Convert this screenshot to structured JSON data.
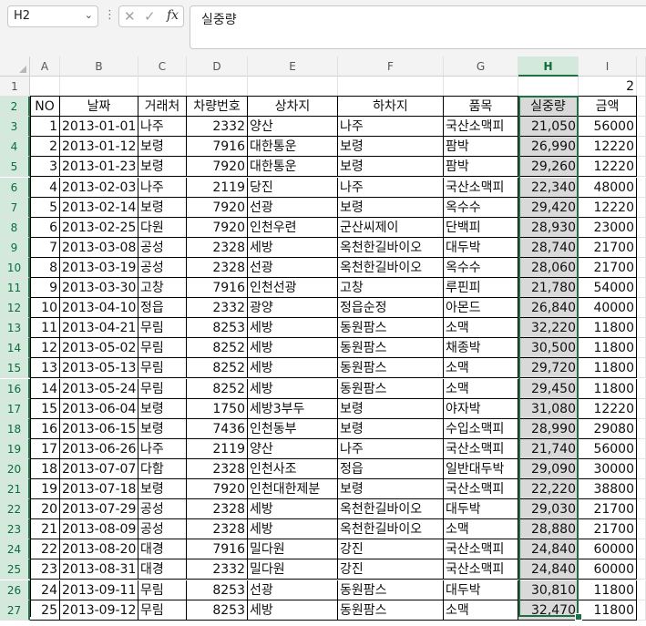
{
  "name_box": {
    "value": "H2"
  },
  "formula_bar": {
    "value": "실중량",
    "fx_label": "fx"
  },
  "columns": [
    "A",
    "B",
    "C",
    "D",
    "E",
    "F",
    "G",
    "H",
    "I"
  ],
  "selected_column": "H",
  "row1": {
    "I": "2"
  },
  "headers": [
    "NO",
    "날짜",
    "거래처",
    "차량번호",
    "상차지",
    "하차지",
    "품목",
    "실중량",
    "금액"
  ],
  "rows": [
    [
      "1",
      "2013-01-01",
      "나주",
      "2332",
      "양산",
      "나주",
      "국산소맥피",
      "21,050",
      "56000"
    ],
    [
      "2",
      "2013-01-12",
      "보령",
      "7916",
      "대한통운",
      "보령",
      "팜박",
      "26,990",
      "12220"
    ],
    [
      "3",
      "2013-01-23",
      "보령",
      "7920",
      "대한통운",
      "보령",
      "팜박",
      "29,260",
      "12220"
    ],
    [
      "4",
      "2013-02-03",
      "나주",
      "2119",
      "당진",
      "나주",
      "국산소맥피",
      "22,340",
      "48000"
    ],
    [
      "5",
      "2013-02-14",
      "보령",
      "7920",
      "선광",
      "보령",
      "옥수수",
      "29,420",
      "12220"
    ],
    [
      "6",
      "2013-02-25",
      "다원",
      "7920",
      "인천우련",
      "군산씨제이",
      "단백피",
      "28,930",
      "23000"
    ],
    [
      "7",
      "2013-03-08",
      "공성",
      "2328",
      "세방",
      "옥천한길바이오",
      "대두박",
      "28,740",
      "21700"
    ],
    [
      "8",
      "2013-03-19",
      "공성",
      "2328",
      "선광",
      "옥천한길바이오",
      "옥수수",
      "28,060",
      "21700"
    ],
    [
      "9",
      "2013-03-30",
      "고창",
      "7916",
      "인천선광",
      "고창",
      "루핀피",
      "21,780",
      "54000"
    ],
    [
      "10",
      "2013-04-10",
      "정읍",
      "2332",
      "광양",
      "정읍순정",
      "아몬드",
      "26,840",
      "40000"
    ],
    [
      "11",
      "2013-04-21",
      "무림",
      "8253",
      "세방",
      "동원팜스",
      "소맥",
      "32,220",
      "11800"
    ],
    [
      "12",
      "2013-05-02",
      "무림",
      "8252",
      "세방",
      "동원팜스",
      "채종박",
      "30,500",
      "11800"
    ],
    [
      "13",
      "2013-05-13",
      "무림",
      "8252",
      "세방",
      "동원팜스",
      "소맥",
      "29,720",
      "11800"
    ],
    [
      "14",
      "2013-05-24",
      "무림",
      "8252",
      "세방",
      "동원팜스",
      "소맥",
      "29,450",
      "11800"
    ],
    [
      "15",
      "2013-06-04",
      "보령",
      "1750",
      "세방3부두",
      "보령",
      "야자박",
      "31,080",
      "12220"
    ],
    [
      "16",
      "2013-06-15",
      "보령",
      "7436",
      "인천동부",
      "보령",
      "수입소맥피",
      "28,990",
      "29080"
    ],
    [
      "17",
      "2013-06-26",
      "나주",
      "2119",
      "양산",
      "나주",
      "국산소맥피",
      "21,740",
      "56000"
    ],
    [
      "18",
      "2013-07-07",
      "다함",
      "2328",
      "인천사조",
      "정읍",
      "일반대두박",
      "29,090",
      "30000"
    ],
    [
      "19",
      "2013-07-18",
      "보령",
      "7920",
      "인천대한제분",
      "보령",
      "국산소맥피",
      "22,220",
      "38800"
    ],
    [
      "20",
      "2013-07-29",
      "공성",
      "2328",
      "세방",
      "옥천한길바이오",
      "대두박",
      "29,030",
      "21700"
    ],
    [
      "21",
      "2013-08-09",
      "공성",
      "2328",
      "세방",
      "옥천한길바이오",
      "소맥",
      "28,880",
      "21700"
    ],
    [
      "22",
      "2013-08-20",
      "대경",
      "7916",
      "밀다원",
      "강진",
      "국산소맥피",
      "24,840",
      "60000"
    ],
    [
      "23",
      "2013-08-31",
      "대경",
      "2332",
      "밀다원",
      "강진",
      "국산소맥피",
      "24,840",
      "60000"
    ],
    [
      "24",
      "2013-09-11",
      "무림",
      "8253",
      "선광",
      "동원팜스",
      "대두박",
      "30,810",
      "11800"
    ],
    [
      "25",
      "2013-09-12",
      "무림",
      "8253",
      "세방",
      "동원팜스",
      "소맥",
      "32,470",
      "11800"
    ]
  ],
  "row_numbers": [
    "1",
    "2",
    "3",
    "4",
    "5",
    "6",
    "7",
    "8",
    "9",
    "10",
    "11",
    "12",
    "13",
    "14",
    "15",
    "16",
    "17",
    "18",
    "19",
    "20",
    "21",
    "22",
    "23",
    "24",
    "25",
    "26",
    "27"
  ],
  "colors": {
    "selection": "#1e7145",
    "selected_fill": "#d9d9d9",
    "header_fill": "#d3e9dc"
  }
}
